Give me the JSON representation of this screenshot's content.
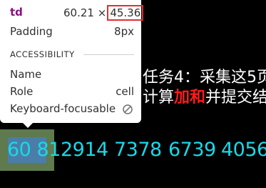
{
  "page": {
    "line1": "任务4：采集这5页",
    "line2_prefix": "计算",
    "line2_red": "加和",
    "line2_suffix": "并提交结"
  },
  "table": {
    "cells": [
      "60 81",
      "2914",
      "7378",
      "6739",
      "4056"
    ]
  },
  "tooltip": {
    "tag": "td",
    "width": "60.21",
    "times": "×",
    "height": "45.36",
    "padding_label": "Padding",
    "padding_value": "8px",
    "section_title": "ACCESSIBILITY",
    "name_label": "Name",
    "role_label": "Role",
    "role_value": "cell",
    "focus_label": "Keyboard-focusable",
    "focus_icon": "not-allowed-icon"
  },
  "colors": {
    "tag": "#881280",
    "highlight_margin": "#5e7a4e",
    "highlight_content": "#4a7ea8",
    "cell_text": "#1ad8e8",
    "emphasis_red": "#ff1a1a",
    "size_box": "#e03030"
  }
}
